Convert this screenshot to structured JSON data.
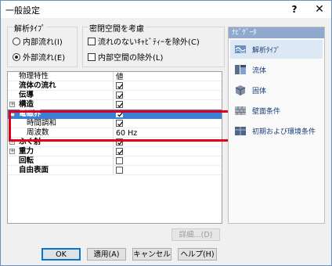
{
  "window": {
    "title": "一般設定",
    "help": "?",
    "close": "✕"
  },
  "analysis_type": {
    "label": "解析ﾀｲﾌﾟ",
    "options": [
      "内部流れ(I)",
      "外部流れ(E)"
    ],
    "selected": "外部流れ(E)"
  },
  "closed_space": {
    "label": "密閉空間を考慮",
    "options": [
      {
        "label": "流れのないｷｬﾋﾞﾃｨｰを除外(C)",
        "checked": false
      },
      {
        "label": "内部空間の除外(L)",
        "checked": false
      }
    ]
  },
  "grid": {
    "headers": {
      "name": "物理特性",
      "value": "値"
    },
    "rows": [
      {
        "name": "流体の流れ",
        "bold": true,
        "checked": true
      },
      {
        "name": "伝導",
        "bold": true,
        "checked": true
      },
      {
        "name": "構造",
        "bold": true,
        "expand": "+",
        "checked": true
      },
      {
        "name": "電磁界",
        "bold": true,
        "expand": "−",
        "checked": true,
        "selected": true
      },
      {
        "name": "時間調和",
        "bold": false,
        "child": true,
        "checked": true
      },
      {
        "name": "周波数",
        "bold": false,
        "child": true,
        "value": "60 Hz"
      },
      {
        "name": "ふく射",
        "bold": true,
        "expand": "+",
        "checked": true
      },
      {
        "name": "重力",
        "bold": true,
        "expand": "+",
        "checked": true
      },
      {
        "name": "回転",
        "bold": true,
        "checked": false
      },
      {
        "name": "自由表面",
        "bold": true,
        "checked": false
      }
    ]
  },
  "navigator": {
    "title": "ﾅﾋﾞｹﾞｰﾀ",
    "items": [
      {
        "label": "解析ﾀｲﾌﾟ",
        "icon": "analysis-type-icon",
        "selected": true
      },
      {
        "label": "流体",
        "icon": "fluid-icon",
        "selected": false
      },
      {
        "label": "固体",
        "icon": "solid-icon",
        "selected": false
      },
      {
        "label": "壁面条件",
        "icon": "wall-condition-icon",
        "selected": false
      },
      {
        "label": "初期および環境条件",
        "icon": "initial-condition-icon",
        "selected": false
      }
    ]
  },
  "buttons": {
    "details": "詳細...(D)",
    "ok": "OK",
    "apply": "適用(A)",
    "cancel": "キャンセル",
    "help": "ヘルプ(H)"
  },
  "colors": {
    "selection": "#3a80d4",
    "highlight_box": "#e0001a",
    "nav_header": "#8fa9cf"
  }
}
